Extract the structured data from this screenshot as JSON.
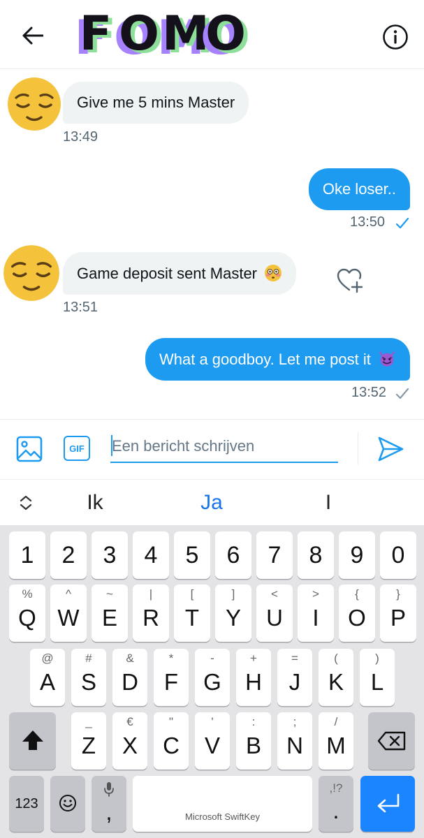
{
  "header": {
    "logo_letters": [
      "F",
      "O",
      "M",
      "O"
    ],
    "back_icon": "arrow-left-icon",
    "info_icon": "info-circle-icon"
  },
  "messages": [
    {
      "direction": "in",
      "text": "Give me 5 mins Master",
      "time": "13:49",
      "avatar": "relieved-face-emoji"
    },
    {
      "direction": "out",
      "text": "Oke loser..",
      "time": "13:50",
      "status": "read-check"
    },
    {
      "direction": "in",
      "text": "Game deposit sent Master",
      "emoji": "flushed-face-emoji",
      "time": "13:51",
      "avatar": "relieved-face-emoji",
      "action_icon": "heart-plus-icon"
    },
    {
      "direction": "out",
      "text": "What a goodboy. Let me post it",
      "emoji": "smiling-imp-emoji",
      "time": "13:52",
      "status": "sent-check"
    }
  ],
  "composer": {
    "placeholder": "Een bericht schrijven",
    "gif_label": "GIF",
    "media_icon": "image-icon",
    "send_icon": "send-icon"
  },
  "suggestions": {
    "expand_icon": "chevron-updown-icon",
    "items": [
      "Ik",
      "Ja",
      "I"
    ]
  },
  "keyboard": {
    "number_row": [
      "1",
      "2",
      "3",
      "4",
      "5",
      "6",
      "7",
      "8",
      "9",
      "0"
    ],
    "row1": [
      {
        "key": "Q",
        "sec": "%"
      },
      {
        "key": "W",
        "sec": "^"
      },
      {
        "key": "E",
        "sec": "~"
      },
      {
        "key": "R",
        "sec": "|"
      },
      {
        "key": "T",
        "sec": "["
      },
      {
        "key": "Y",
        "sec": "]"
      },
      {
        "key": "U",
        "sec": "<"
      },
      {
        "key": "I",
        "sec": ">"
      },
      {
        "key": "O",
        "sec": "{"
      },
      {
        "key": "P",
        "sec": "}"
      }
    ],
    "row2": [
      {
        "key": "A",
        "sec": "@"
      },
      {
        "key": "S",
        "sec": "#"
      },
      {
        "key": "D",
        "sec": "&"
      },
      {
        "key": "F",
        "sec": "*"
      },
      {
        "key": "G",
        "sec": "-"
      },
      {
        "key": "H",
        "sec": "+"
      },
      {
        "key": "J",
        "sec": "="
      },
      {
        "key": "K",
        "sec": "("
      },
      {
        "key": "L",
        "sec": ")"
      }
    ],
    "row3": [
      {
        "key": "Z",
        "sec": "_"
      },
      {
        "key": "X",
        "sec": "€"
      },
      {
        "key": "C",
        "sec": "\""
      },
      {
        "key": "V",
        "sec": "'"
      },
      {
        "key": "B",
        "sec": ":"
      },
      {
        "key": "N",
        "sec": ";"
      },
      {
        "key": "M",
        "sec": "/"
      }
    ],
    "symbols_label": "123",
    "comma_label": ",",
    "space_label": "Microsoft SwiftKey",
    "punct_sec": ",!?",
    "period_label": ".",
    "shift_icon": "shift-arrow-icon",
    "backspace_icon": "backspace-icon",
    "emoji_icon": "smiley-icon",
    "mic_icon": "microphone-icon",
    "enter_icon": "enter-return-icon"
  },
  "colors": {
    "accent": "#1d9bf0",
    "bubble_in": "#eff3f4",
    "keyboard_bg": "#e4e4e6",
    "enter_key": "#1a85ff"
  }
}
